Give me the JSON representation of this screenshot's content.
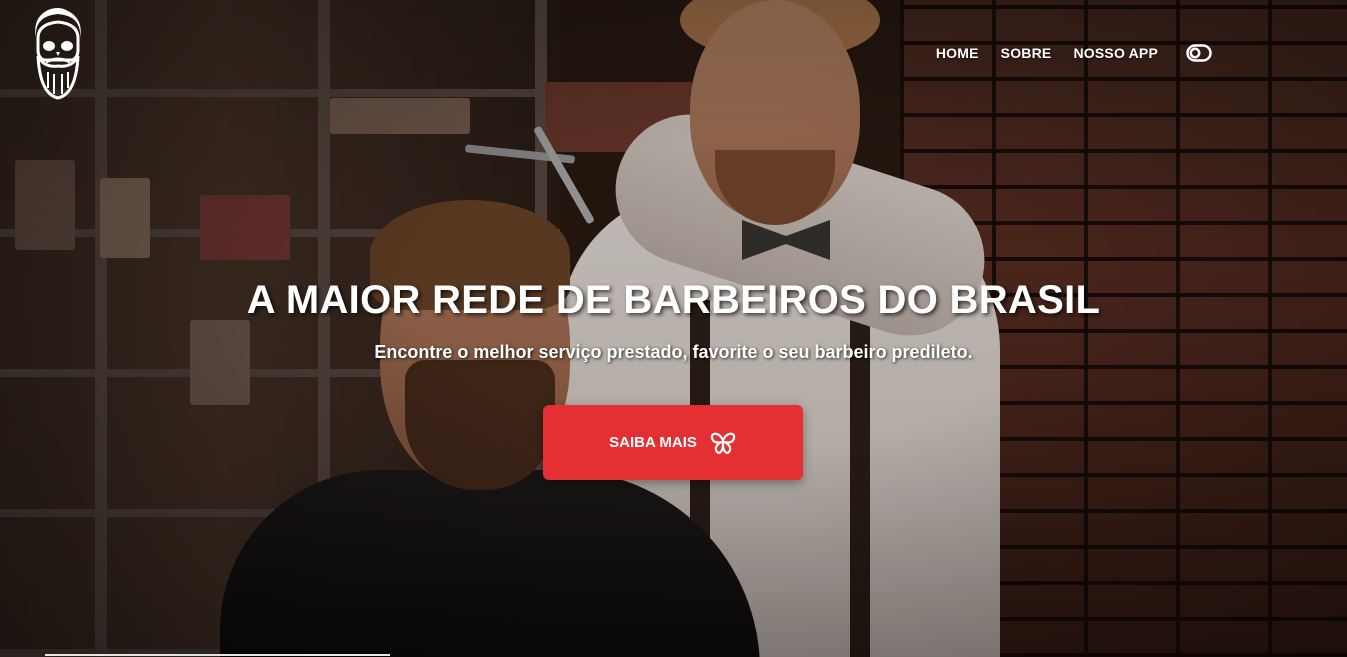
{
  "brand": {
    "logo_icon": "bearded-skull-icon"
  },
  "nav": {
    "items": [
      {
        "label": "HOME"
      },
      {
        "label": "SOBRE"
      },
      {
        "label": "NOSSO APP"
      }
    ],
    "toggle_icon": "toggle-icon"
  },
  "hero": {
    "title": "A MAIOR REDE DE BARBEIROS DO BRASIL",
    "subtitle": "Encontre o melhor serviço prestado, favorite o seu barbeiro predileto.",
    "cta_label": "SAIBA MAIS",
    "cta_icon": "butterfly-icon",
    "background_image": "barber-cutting-client-hair-photo"
  },
  "colors": {
    "accent": "#e43033",
    "text": "#ffffff"
  }
}
